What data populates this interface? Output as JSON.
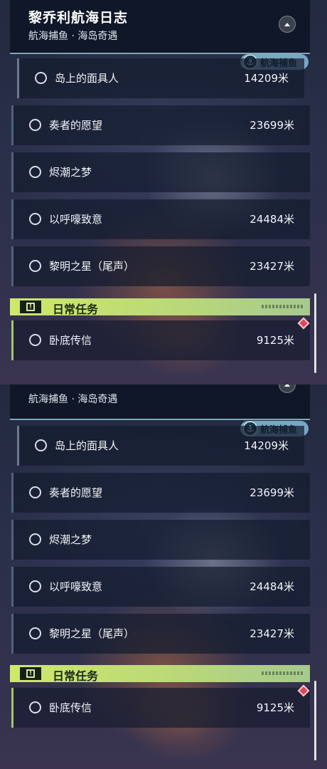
{
  "panels": [
    {
      "header": {
        "title": "黎乔利航海日志",
        "subtitle": "航海捕鱼 · 海岛奇遇"
      },
      "tag": {
        "icon": "anchor-icon",
        "label": "航海捕鱼"
      },
      "quests": [
        {
          "name": "岛上的面具人",
          "distance": "14209米"
        },
        {
          "name": "奏者的愿望",
          "distance": "23699米"
        },
        {
          "name": "烬潮之梦",
          "distance": ""
        },
        {
          "name": "以呼嚎致意",
          "distance": "24484米"
        },
        {
          "name": "黎明之星（尾声）",
          "distance": "23427米"
        }
      ],
      "daily": {
        "title": "日常任务",
        "icon": "exclamation-icon"
      },
      "daily_quests": [
        {
          "name": "卧底传信",
          "distance": "9125米"
        }
      ]
    },
    {
      "header": {
        "title": "",
        "subtitle": "航海捕鱼 · 海岛奇遇"
      },
      "tag": {
        "icon": "anchor-icon",
        "label": "航海捕鱼"
      },
      "quests": [
        {
          "name": "岛上的面具人",
          "distance": "14209米"
        },
        {
          "name": "奏者的愿望",
          "distance": "23699米"
        },
        {
          "name": "烬潮之梦",
          "distance": ""
        },
        {
          "name": "以呼嚎致意",
          "distance": "24484米"
        },
        {
          "name": "黎明之星（尾声）",
          "distance": "23427米"
        }
      ],
      "daily": {
        "title": "日常任务",
        "icon": "exclamation-icon"
      },
      "daily_quests": [
        {
          "name": "卧底传信",
          "distance": "9125米"
        }
      ]
    }
  ],
  "colors": {
    "daily_accent": "#cfe86a",
    "tracking_marker": "#e0455a",
    "tag_badge": "#96d2e6"
  }
}
